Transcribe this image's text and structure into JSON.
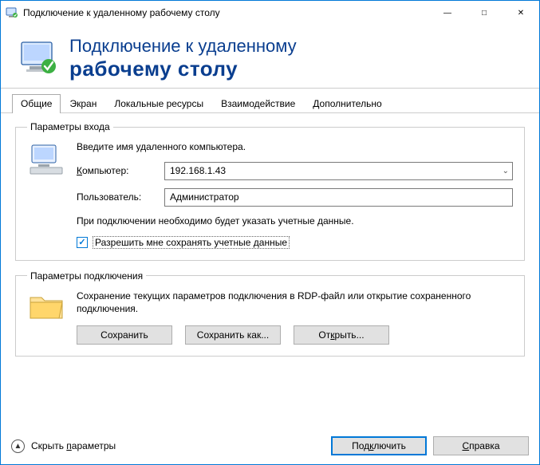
{
  "titlebar": {
    "title": "Подключение к удаленному рабочему столу"
  },
  "header": {
    "line1": "Подключение к удаленному",
    "line2": "рабочему столу"
  },
  "tabs": {
    "general": "Общие",
    "display": "Экран",
    "local": "Локальные ресурсы",
    "experience": "Взаимодействие",
    "advanced": "Дополнительно"
  },
  "login": {
    "legend": "Параметры входа",
    "intro": "Введите имя удаленного компьютера.",
    "computer_label": "Компьютер:",
    "computer_value": "192.168.1.43",
    "user_label": "Пользователь:",
    "user_value": "Администратор",
    "hint": "При подключении необходимо будет указать учетные данные.",
    "save_cred_label": "Разрешить мне сохранять учетные данные"
  },
  "conn": {
    "legend": "Параметры подключения",
    "desc": "Сохранение текущих параметров подключения в RDP-файл или открытие сохраненного подключения.",
    "save": "Сохранить",
    "save_as": "Сохранить как...",
    "open": "Открыть..."
  },
  "footer": {
    "hide": "Скрыть параметры",
    "connect": "Подключить",
    "help": "Справка"
  }
}
